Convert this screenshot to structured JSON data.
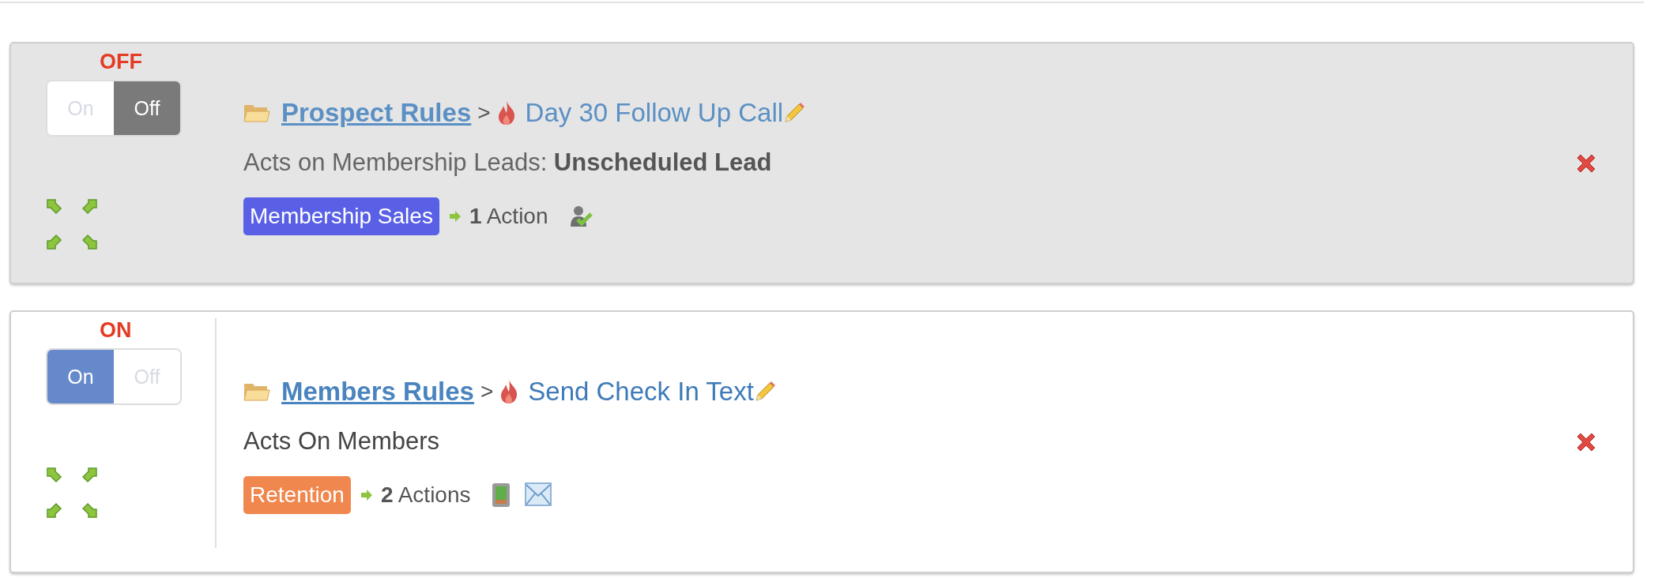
{
  "rules": [
    {
      "on": false,
      "status": "OFF",
      "toggle": [
        {
          "kind": "on",
          "label": "On",
          "selected": false
        },
        {
          "kind": "off",
          "label": "Off",
          "selected": true
        }
      ],
      "folder": "Prospect Rules",
      "separator": ">",
      "name": "Day 30 Follow Up Call",
      "description": "Acts on Membership Leads: **Unscheduled Lead**",
      "tag": {
        "label": "Membership Sales",
        "color": "#5960e6"
      },
      "action_count": "1",
      "action_label": "Action",
      "action_icons": [
        {
          "kind": "user-check"
        }
      ]
    },
    {
      "on": true,
      "status": "ON",
      "toggle": [
        {
          "kind": "on",
          "label": "On",
          "selected": true
        },
        {
          "kind": "off",
          "label": "Off",
          "selected": false
        }
      ],
      "folder": "Members Rules",
      "separator": ">",
      "name": "Send Check In Text",
      "description": "Acts On Members",
      "tag": {
        "label": "Retention",
        "color": "#f0874e"
      },
      "action_count": "2",
      "action_label": "Actions",
      "action_icons": [
        {
          "kind": "phone"
        },
        {
          "kind": "email"
        }
      ]
    }
  ]
}
